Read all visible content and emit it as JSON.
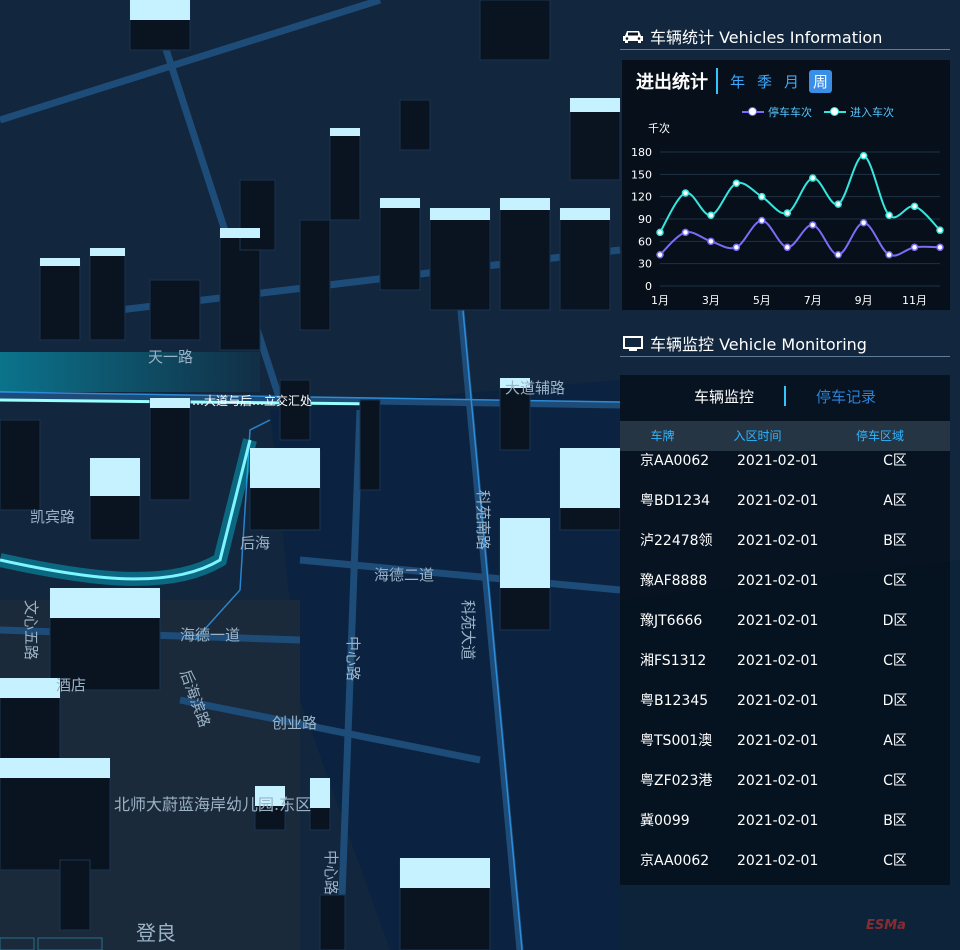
{
  "map": {
    "labels": {
      "tianyilu": "天一路",
      "kaibinlu": "凯宾路",
      "houhai": "后海",
      "haide_erdao": "海德二道",
      "haide_yidao": "海德一道",
      "zhongxinlu": "中心路",
      "keyuan_dadao": "科苑大道",
      "keyuan_nanlu": "科苑南路",
      "houhaibinlu": "后海滨路",
      "chuangyelu": "创业路",
      "kindergarten": "北师大蔚蓝海岸幼儿园.东区",
      "jiudian": "酒店",
      "denglang": "登良",
      "wenxinlu": "文心五路",
      "junction": "…大道与后…立交汇处",
      "dadao_fulu": "大道辅路"
    }
  },
  "stats": {
    "title": "车辆统计 Vehicles Information",
    "subtitle": "进出统计",
    "tabs": [
      "年",
      "季",
      "月",
      "周"
    ],
    "active_tab": "周",
    "legend": {
      "park": "停车车次",
      "enter": "进入车次"
    },
    "y_unit": "千次"
  },
  "chart_data": {
    "type": "line",
    "x": [
      "1月",
      "2月",
      "3月",
      "4月",
      "5月",
      "6月",
      "7月",
      "8月",
      "9月",
      "10月",
      "11月",
      "12月"
    ],
    "x_tick_labels": [
      "1月",
      "3月",
      "5月",
      "7月",
      "9月",
      "11月"
    ],
    "ylim": [
      0,
      180
    ],
    "y_ticks": [
      0,
      30,
      60,
      90,
      120,
      150,
      180
    ],
    "ylabel": "千次",
    "series": [
      {
        "name": "停车车次",
        "color": "#7b6cf6",
        "values": [
          42,
          72,
          60,
          52,
          88,
          52,
          82,
          42,
          85,
          42,
          52,
          52
        ]
      },
      {
        "name": "进入车次",
        "color": "#35e6df",
        "values": [
          72,
          125,
          95,
          138,
          120,
          98,
          145,
          110,
          175,
          95,
          107,
          75
        ]
      }
    ]
  },
  "monitor": {
    "title": "车辆监控 Vehicle Monitoring",
    "tabs": {
      "monitor": "车辆监控",
      "records": "停车记录"
    },
    "headers": {
      "plate": "车牌",
      "time": "入区时间",
      "zone": "停车区域"
    },
    "rows": [
      {
        "plate": "京AA0062",
        "time": "2021-02-01",
        "zone": "C区"
      },
      {
        "plate": "粤BD1234",
        "time": "2021-02-01",
        "zone": "A区"
      },
      {
        "plate": "泸22478领",
        "time": "2021-02-01",
        "zone": "B区"
      },
      {
        "plate": "豫AF8888",
        "time": "2021-02-01",
        "zone": "C区"
      },
      {
        "plate": "豫JT6666",
        "time": "2021-02-01",
        "zone": "D区"
      },
      {
        "plate": "湘FS1312",
        "time": "2021-02-01",
        "zone": "C区"
      },
      {
        "plate": "粤B12345",
        "time": "2021-02-01",
        "zone": "D区"
      },
      {
        "plate": "粤TS001澳",
        "time": "2021-02-01",
        "zone": "A区"
      },
      {
        "plate": "粤ZF023港",
        "time": "2021-02-01",
        "zone": "C区"
      },
      {
        "plate": "冀0099",
        "time": "2021-02-01",
        "zone": "B区"
      },
      {
        "plate": "京AA0062",
        "time": "2021-02-01",
        "zone": "C区"
      }
    ]
  },
  "watermark": "ESMa"
}
